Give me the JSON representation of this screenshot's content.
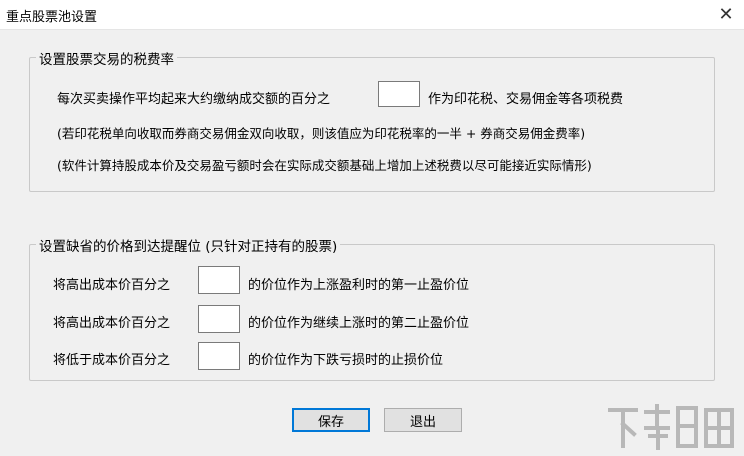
{
  "window": {
    "title": "重点股票池设置",
    "close_glyph": "✕"
  },
  "tax_group": {
    "legend": "设置股票交易的税费率",
    "line_prefix": "每次买卖操作平均起来大约缴纳成交额的百分之",
    "line_suffix": "作为印花税、交易佣金等各项税费",
    "fee_value": "",
    "note1": "(若印花税单向收取而券商交易佣金双向收取，则该值应为印花税率的一半 + 券商交易佣金费率)",
    "note2": "(软件计算持股成本价及交易盈亏额时会在实际成交额基础上增加上述税费以尽可能接近实际情形)"
  },
  "alert_group": {
    "legend": "设置缺省的价格到达提醒位 (只针对正持有的股票)",
    "rows": [
      {
        "prefix": "将高出成本价百分之",
        "value": "",
        "suffix": "的价位作为上涨盈利时的第一止盈价位"
      },
      {
        "prefix": "将高出成本价百分之",
        "value": "",
        "suffix": "的价位作为继续上涨时的第二止盈价位"
      },
      {
        "prefix": "将低于成本价百分之",
        "value": "",
        "suffix": "的价位作为下跌亏损时的止损价位"
      }
    ]
  },
  "buttons": {
    "save": "保存",
    "exit": "退出"
  },
  "watermark_icon": "xiazaiba-watermark-icon"
}
